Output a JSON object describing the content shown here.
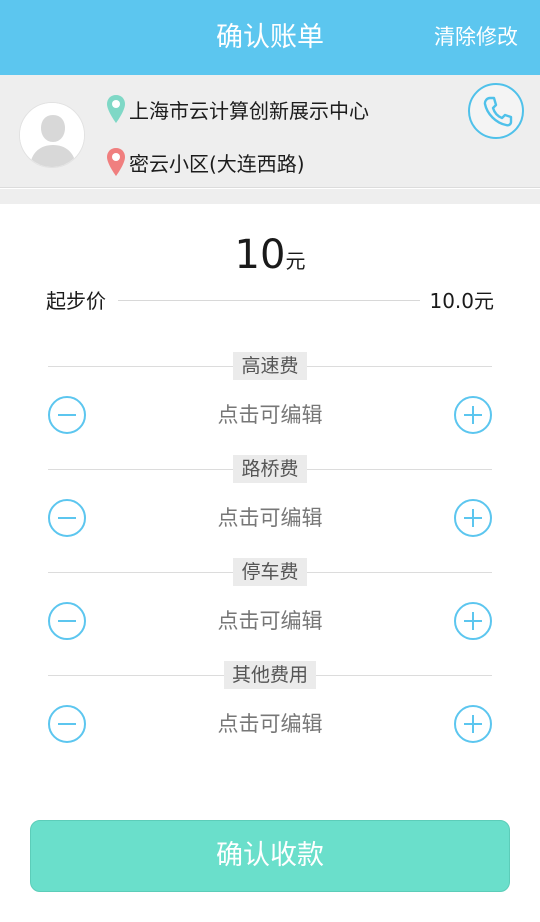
{
  "header": {
    "title": "确认账单",
    "action_label": "清除修改",
    "background": "#5cc6ef"
  },
  "route": {
    "start": {
      "icon": "location-pin-green-icon",
      "color": "#7fd8c6",
      "text": "上海市云计算创新展示中心"
    },
    "end": {
      "icon": "location-pin-red-icon",
      "color": "#f07f7f",
      "text": "密云小区(大连西路)"
    },
    "avatar_icon": "user-avatar-icon",
    "call_icon": "phone-icon"
  },
  "fare": {
    "amount": "10",
    "unit": "元",
    "base_label": "起步价",
    "base_value": "10.0元"
  },
  "fees": [
    {
      "label": "高速费",
      "value": "点击可编辑"
    },
    {
      "label": "路桥费",
      "value": "点击可编辑"
    },
    {
      "label": "停车费",
      "value": "点击可编辑"
    },
    {
      "label": "其他费用",
      "value": "点击可编辑"
    }
  ],
  "fee_buttons": {
    "minus_icon": "minus-circle-icon",
    "plus_icon": "plus-circle-icon",
    "accent": "#5cc6ef"
  },
  "confirm": {
    "label": "确认收款",
    "color": "#6adfcb"
  }
}
